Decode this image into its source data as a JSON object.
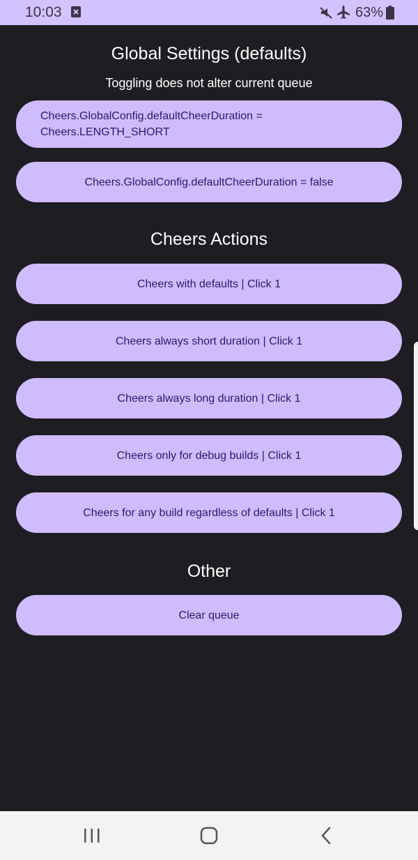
{
  "status_bar": {
    "time": "10:03",
    "battery": "63%",
    "icons": [
      "notification-x-icon",
      "mute-icon",
      "airplane-icon",
      "battery-icon"
    ]
  },
  "sections": {
    "global": {
      "title": "Global Settings (defaults)",
      "subtitle": "Toggling does not alter current queue",
      "buttons": [
        "Cheers.GlobalConfig.defaultCheerDuration =\nCheers.LENGTH_SHORT",
        "Cheers.GlobalConfig.defaultCheerDuration = false"
      ]
    },
    "actions": {
      "title": "Cheers Actions",
      "buttons": [
        "Cheers with defaults | Click 1",
        "Cheers always short duration | Click 1",
        "Cheers always long duration | Click 1",
        "Cheers only for debug builds | Click 1",
        "Cheers for any build regardless of defaults | Click 1"
      ]
    },
    "other": {
      "title": "Other",
      "buttons": [
        "Clear queue"
      ]
    }
  },
  "nav_bar": {
    "icons": [
      "recent-apps-icon",
      "home-icon",
      "back-icon"
    ]
  },
  "colors": {
    "background": "#1e1d22",
    "status_bar": "#d2c2ff",
    "button": "#cfbcff",
    "button_text": "#2c1a63",
    "heading_text": "#ffffff",
    "nav_bar": "#f3f3f3"
  }
}
